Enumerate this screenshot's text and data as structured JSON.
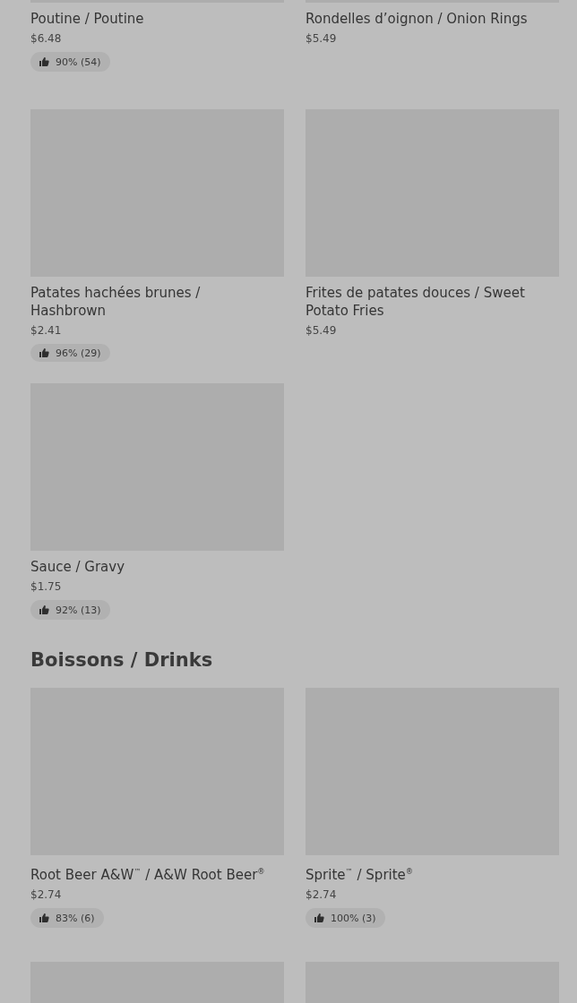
{
  "sections": [
    {
      "items": [
        {
          "name": "Poutine / Poutine",
          "price": "$6.48",
          "rating": "90% (54)"
        },
        {
          "name": "Rondelles d’oignon / Onion Rings",
          "price": "$5.49"
        },
        {
          "name": "Patates hachées brunes / Hashbrown",
          "price": "$2.41",
          "rating": "96% (29)"
        },
        {
          "name": "Frites de patates douces / Sweet Potato Fries",
          "price": "$5.49"
        },
        {
          "name": "Sauce / Gravy",
          "price": "$1.75",
          "rating": "92% (13)"
        }
      ]
    },
    {
      "title": "Boissons / Drinks",
      "items": [
        {
          "name": "Root Beer A&W$^{™}$ / A&W Root Beer$^{®}$",
          "price": "$2.74",
          "rating": "83% (6)"
        },
        {
          "name": "Sprite$^{™}$ / Sprite$^{®}$",
          "price": "$2.74",
          "rating": "100% (3)"
        },
        {
          "kind": "picture"
        },
        {
          "kind": "picture"
        }
      ]
    }
  ]
}
